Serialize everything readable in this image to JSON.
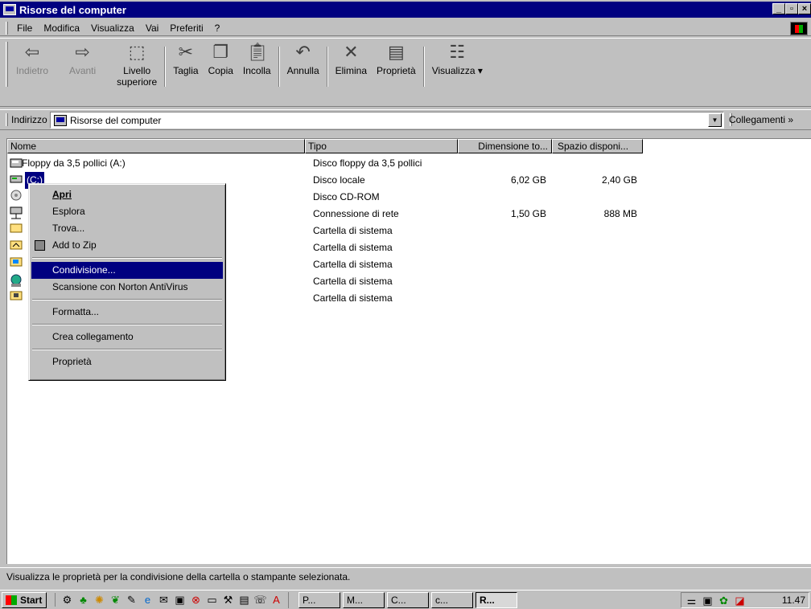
{
  "window": {
    "title": "Risorse del computer"
  },
  "menu": [
    "File",
    "Modifica",
    "Visualizza",
    "Vai",
    "Preferiti",
    "?"
  ],
  "toolbar": {
    "back": "Indietro",
    "forward": "Avanti",
    "up_line1": "Livello",
    "up_line2": "superiore",
    "cut": "Taglia",
    "copy": "Copia",
    "paste": "Incolla",
    "undo": "Annulla",
    "delete": "Elimina",
    "properties": "Proprietà",
    "views": "Visualizza"
  },
  "address": {
    "label": "Indirizzo",
    "value": "Risorse del computer",
    "links": "Collegamenti"
  },
  "columns": [
    "Nome",
    "Tipo",
    "Dimensione to...",
    "Spazio disponi..."
  ],
  "rows": [
    {
      "name": "Floppy da 3,5 pollici (A:)",
      "type": "Disco floppy da 3,5 pollici",
      "size": "",
      "free": ""
    },
    {
      "name": "(C:)",
      "type": "Disco locale",
      "size": "6,02 GB",
      "free": "2,40 GB"
    },
    {
      "name": "",
      "type": "Disco CD-ROM",
      "size": "",
      "free": ""
    },
    {
      "name": "",
      "type": "Connessione di rete",
      "size": "1,50 GB",
      "free": "888 MB"
    },
    {
      "name": "",
      "type": "Cartella di sistema",
      "size": "",
      "free": ""
    },
    {
      "name": "",
      "type": "Cartella di sistema",
      "size": "",
      "free": ""
    },
    {
      "name": "",
      "type": "Cartella di sistema",
      "size": "",
      "free": ""
    },
    {
      "name": "",
      "type": "Cartella di sistema",
      "size": "",
      "free": ""
    },
    {
      "name": "",
      "type": "Cartella di sistema",
      "size": "",
      "free": ""
    }
  ],
  "context_menu": {
    "open": "Apri",
    "explore": "Esplora",
    "find": "Trova...",
    "zip": "Add to Zip",
    "share": "Condivisione...",
    "scan": "Scansione con Norton AntiVirus",
    "format": "Formatta...",
    "shortcut": "Crea collegamento",
    "props": "Proprietà"
  },
  "status": "Visualizza le proprietà per la condivisione della cartella o stampante selezionata.",
  "taskbar": {
    "start": "Start",
    "tasks": [
      "P...",
      "M...",
      "C...",
      "c...",
      "R..."
    ],
    "clock": "11.47"
  }
}
